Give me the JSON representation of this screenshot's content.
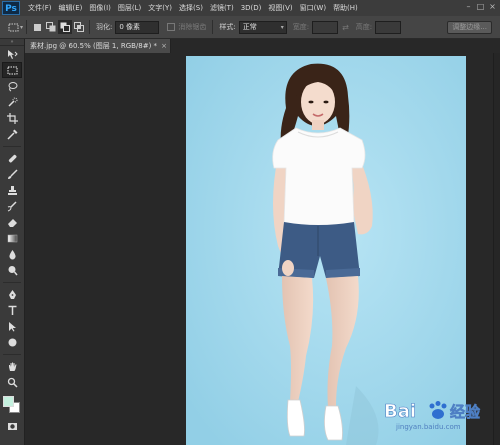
{
  "app": {
    "logo": "Ps"
  },
  "menubar": {
    "items": [
      "文件(F)",
      "编辑(E)",
      "图像(I)",
      "图层(L)",
      "文字(Y)",
      "选择(S)",
      "滤镜(T)",
      "3D(D)",
      "视图(V)",
      "窗口(W)",
      "帮助(H)"
    ]
  },
  "options": {
    "feather_label": "羽化:",
    "feather_value": "0 像素",
    "antialias_label": "消除锯齿",
    "style_label": "样式:",
    "style_value": "正常",
    "width_label": "宽度:",
    "height_label": "高度:",
    "refine_edge_label": "调整边缘..."
  },
  "document": {
    "tab_title": "素材.jpg @ 60.5% (图层 1, RGB/8#) *"
  },
  "swatches": {
    "foreground": "#c4f0de",
    "background": "#ffffff"
  },
  "watermark": {
    "brand": "Bai",
    "brand2": "经验",
    "url": "jingyan.baidu.com"
  },
  "colors": {
    "photo_backdrop": "#a6dbef",
    "accent": "#31a8ff"
  }
}
